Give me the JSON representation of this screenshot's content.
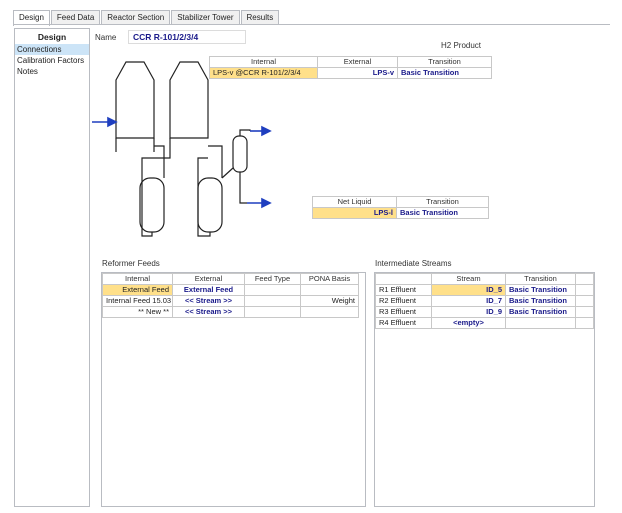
{
  "tabs": [
    "Design",
    "Feed Data",
    "Reactor Section",
    "Stabilizer Tower",
    "Results"
  ],
  "left_pane": {
    "title": "Design",
    "items": [
      "Connections",
      "Calibration Factors",
      "Notes"
    ]
  },
  "name": {
    "label": "Name",
    "value": "CCR R-101/2/3/4"
  },
  "h2_product": {
    "title": "H2 Product",
    "headers": [
      "Internal",
      "External",
      "Transition"
    ],
    "row": {
      "internal": "LPS-v @CCR R-101/2/3/4",
      "external": "LPS-v",
      "transition": "Basic Transition"
    }
  },
  "net_liquid": {
    "headers": [
      "Net Liquid",
      "Transition"
    ],
    "row": {
      "net_liquid": "LPS-l",
      "transition": "Basic Transition"
    }
  },
  "reformer_feeds": {
    "title": "Reformer Feeds",
    "headers": [
      "Internal",
      "External",
      "Feed Type",
      "PONA Basis"
    ],
    "rows": [
      {
        "internal": "External Feed",
        "external": "External Feed",
        "feed_type": "",
        "pona": ""
      },
      {
        "internal": "Internal Feed 15.03",
        "external": "<< Stream >>",
        "feed_type": "",
        "pona": "Weight"
      },
      {
        "internal": "** New **",
        "external": "<< Stream >>",
        "feed_type": "",
        "pona": ""
      }
    ]
  },
  "intermediate_streams": {
    "title": "Intermediate Streams",
    "headers": [
      "",
      "Stream",
      "Transition"
    ],
    "rows": [
      {
        "name": "R1 Effluent",
        "stream": "ID_5",
        "transition": "Basic Transition"
      },
      {
        "name": "R2 Effluent",
        "stream": "ID_7",
        "transition": "Basic Transition"
      },
      {
        "name": "R3 Effluent",
        "stream": "ID_9",
        "transition": "Basic Transition"
      },
      {
        "name": "R4 Effluent",
        "stream": "<empty>",
        "transition": ""
      }
    ]
  },
  "colors": {
    "accent": "#1a1a8a",
    "highlight": "#ffe08a",
    "selection": "#cce4f7",
    "arrow": "#1f3fbf"
  }
}
